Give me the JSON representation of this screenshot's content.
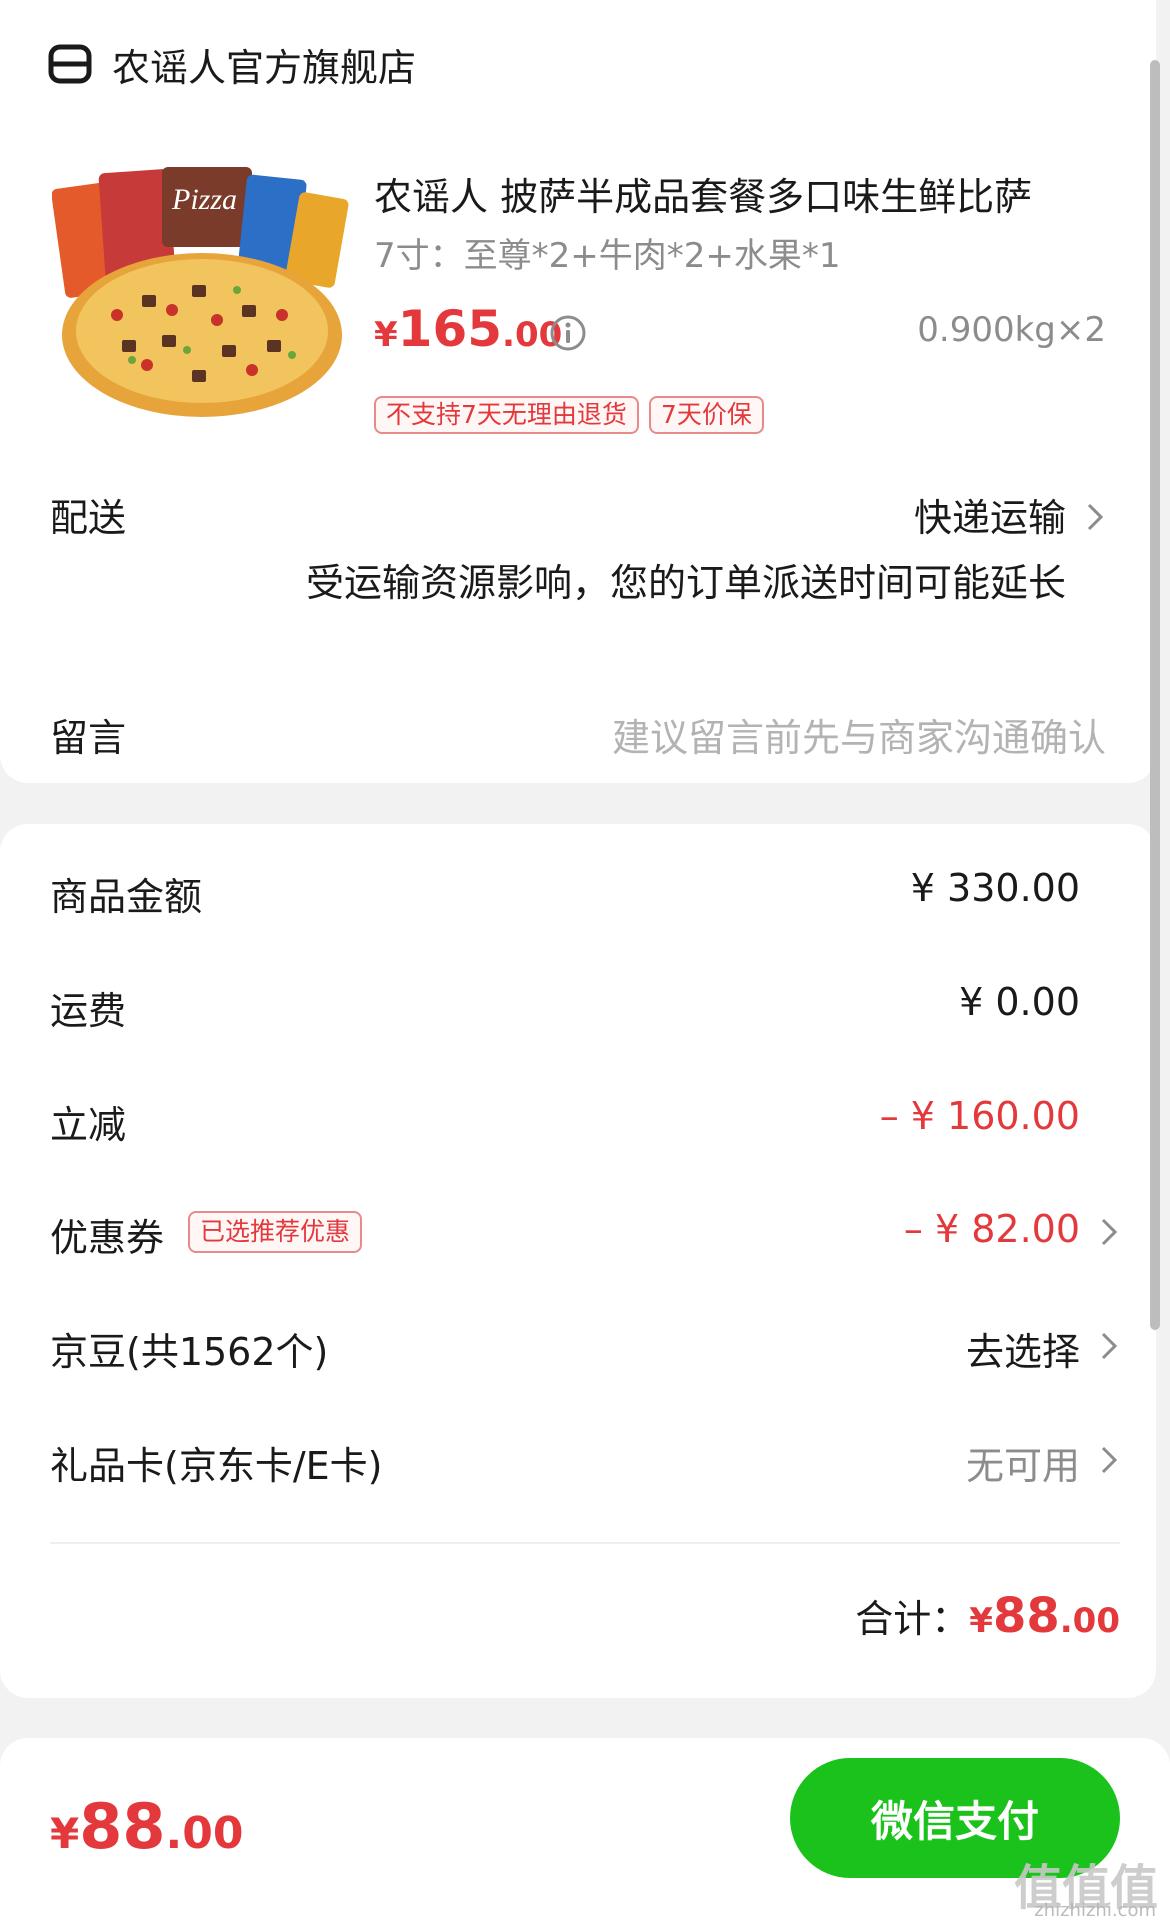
{
  "store": {
    "name": "农谣人官方旗舰店",
    "icon": "store-icon"
  },
  "product": {
    "title": "农谣人 披萨半成品套餐多口味生鲜比萨",
    "spec": "7寸：至尊*2+牛肉*2+水果*1",
    "price_symbol": "¥",
    "price_int": "165",
    "price_dec": ".00",
    "quantity": "0.900kg×2",
    "image_label": "Pizza",
    "tags": [
      "不支持7天无理由退货",
      "7天价保"
    ]
  },
  "delivery": {
    "label": "配送",
    "method": "快递运输",
    "note": "受运输资源影响，您的订单派送时间可能延长"
  },
  "message": {
    "label": "留言",
    "placeholder": "建议留言前先与商家沟通确认"
  },
  "summary": {
    "goods_label": "商品金额",
    "goods_value": "¥ 330.00",
    "shipping_label": "运费",
    "shipping_value": "¥ 0.00",
    "discount_label": "立减",
    "discount_value": "– ¥ 160.00",
    "coupon_label": "优惠券",
    "coupon_tag": "已选推荐优惠",
    "coupon_value": "– ¥ 82.00",
    "jd_beans_label": "京豆(共1562个)",
    "jd_beans_value": "去选择",
    "giftcard_label": "礼品卡(京东卡/E卡)",
    "giftcard_value": "无可用",
    "total_label": "合计：",
    "total_symbol": "¥",
    "total_int": "88",
    "total_dec": ".00"
  },
  "bottom_bar": {
    "price_symbol": "¥",
    "price_int": "88",
    "price_dec": ".00",
    "pay_button": "微信支付"
  },
  "watermark": {
    "text": "值值值",
    "url": "zhizhizhi.com"
  },
  "colors": {
    "accent_red": "#e4393c",
    "pay_green": "#1cc21c"
  }
}
